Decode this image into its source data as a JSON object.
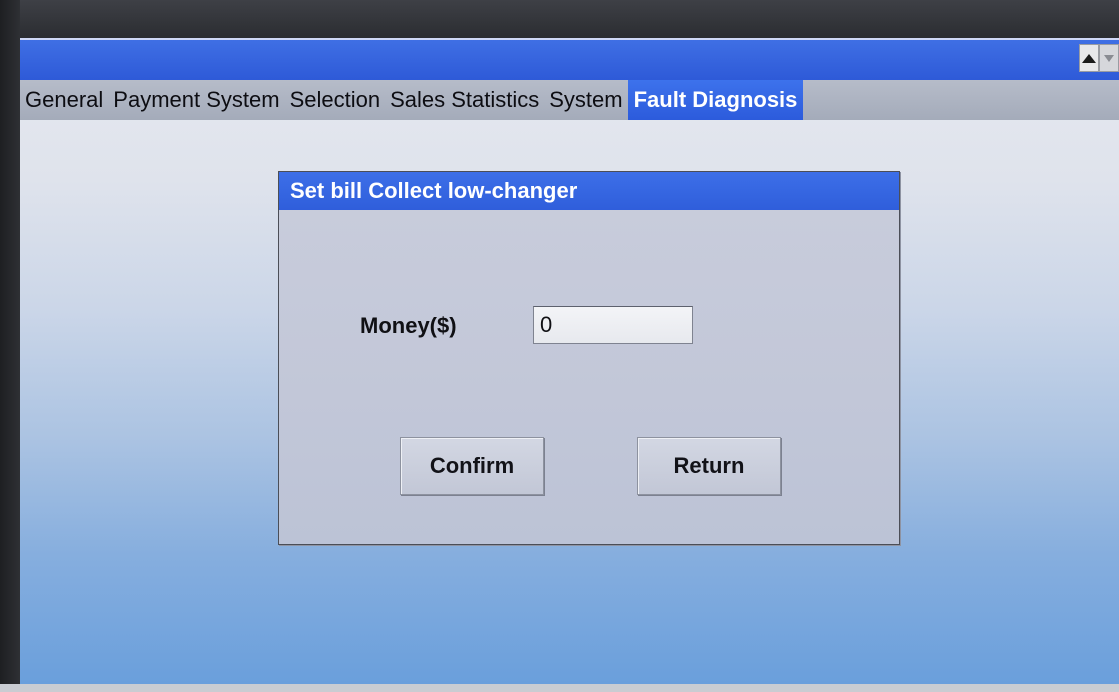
{
  "tabs": [
    {
      "label": "General",
      "active": false
    },
    {
      "label": "Payment System",
      "active": false
    },
    {
      "label": "Selection",
      "active": false
    },
    {
      "label": "Sales Statistics",
      "active": false
    },
    {
      "label": "System",
      "active": false
    },
    {
      "label": "Fault Diagnosis",
      "active": true
    }
  ],
  "scroll": {
    "up_icon": "triangle-up",
    "down_icon": "triangle-down"
  },
  "dialog": {
    "title": "Set bill Collect low-changer",
    "money_label": "Money($)",
    "money_value": "0",
    "confirm_label": "Confirm",
    "return_label": "Return"
  },
  "colors": {
    "accent_blue": "#2f5edb",
    "tabbar_gray": "#a9afbd",
    "dialog_bg": "#c4c9da"
  }
}
